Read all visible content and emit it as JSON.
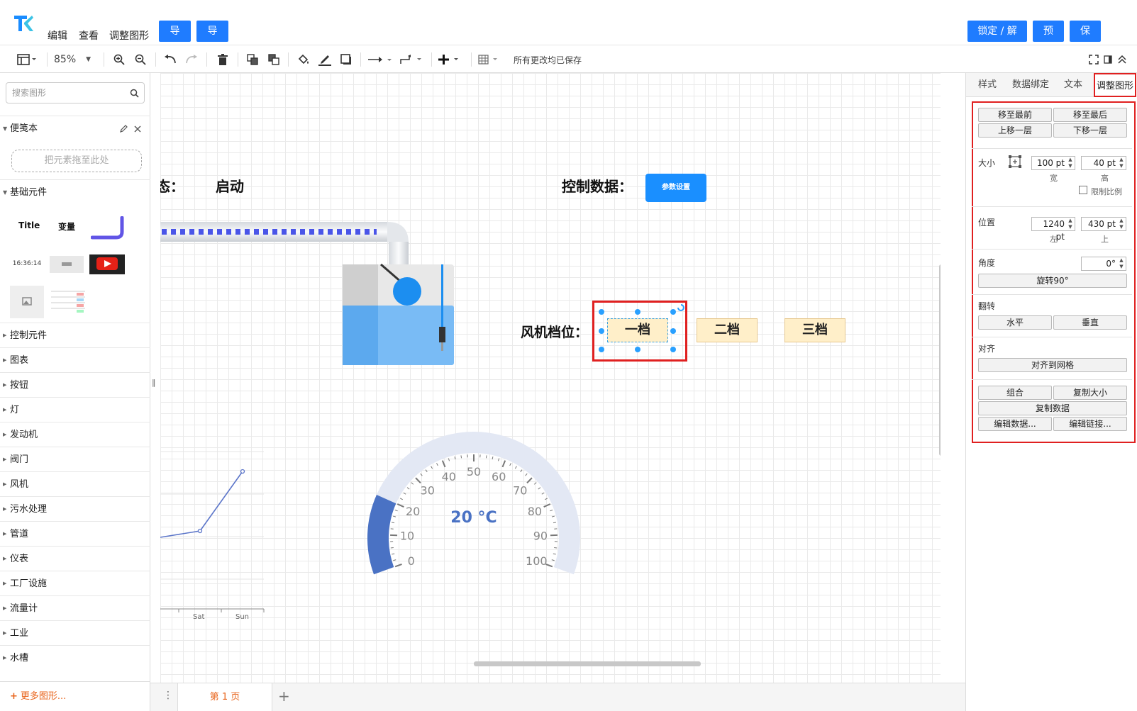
{
  "menubar": {
    "items": [
      "编辑",
      "查看",
      "调整图形"
    ],
    "import_label": "导入",
    "export_label": "导出",
    "lock_label": "锁定 / 解锁",
    "preview_label": "预览",
    "save_label": "保存"
  },
  "toolbar": {
    "zoom": "85%",
    "status": "所有更改均已保存"
  },
  "sidebar": {
    "search_placeholder": "搜索图形",
    "notebook_title": "便笺本",
    "dropzone": "把元素拖至此处",
    "basic_title": "基础元件",
    "basic_title_item": "Title",
    "basic_variable_item": "变量",
    "clock_time": "16:36:14",
    "categories": [
      "控制元件",
      "图表",
      "按钮",
      "灯",
      "发动机",
      "阀门",
      "风机",
      "污水处理",
      "管道",
      "仪表",
      "工厂设施",
      "流量计",
      "工业",
      "水槽"
    ],
    "more_shapes": "更多图形..."
  },
  "canvas": {
    "status_label": "态：",
    "status_value": "启动",
    "control_label": "控制数据：",
    "param_button": "参数设置",
    "fan_label": "风机档位：",
    "gears": [
      "一档",
      "二档",
      "三档"
    ],
    "gauge_value": "20 °C",
    "gauge_ticks": [
      "0",
      "10",
      "20",
      "30",
      "40",
      "50",
      "60",
      "70",
      "80",
      "90",
      "100"
    ],
    "chart_xlabels": [
      "i",
      "Sat",
      "Sun"
    ]
  },
  "bottom": {
    "page_tab": "第 1 页"
  },
  "panel": {
    "tabs": [
      "样式",
      "数据绑定",
      "文本",
      "调整图形"
    ],
    "to_front": "移至最前",
    "to_back": "移至最后",
    "up_layer": "上移一层",
    "down_layer": "下移一层",
    "size_label": "大小",
    "width_value": "100 pt",
    "height_value": "40 pt",
    "width_caption": "宽",
    "height_caption": "高",
    "lock_ratio": "限制比例",
    "position_label": "位置",
    "left_value": "1240 pt",
    "top_value": "430 pt",
    "left_caption": "左",
    "top_caption": "上",
    "angle_label": "角度",
    "angle_value": "0°",
    "rotate": "旋转90°",
    "flip_label": "翻转",
    "flip_h": "水平",
    "flip_v": "垂直",
    "align_label": "对齐",
    "align_grid": "对齐到网格",
    "group": "组合",
    "copy_size": "复制大小",
    "copy_data": "复制数据",
    "edit_data": "编辑数据...",
    "edit_link": "编辑链接..."
  },
  "colors": {
    "primary": "#1f7cff",
    "highlight": "#e02020",
    "gear_fill": "#ffefc9",
    "gauge": "#4a72c4"
  }
}
